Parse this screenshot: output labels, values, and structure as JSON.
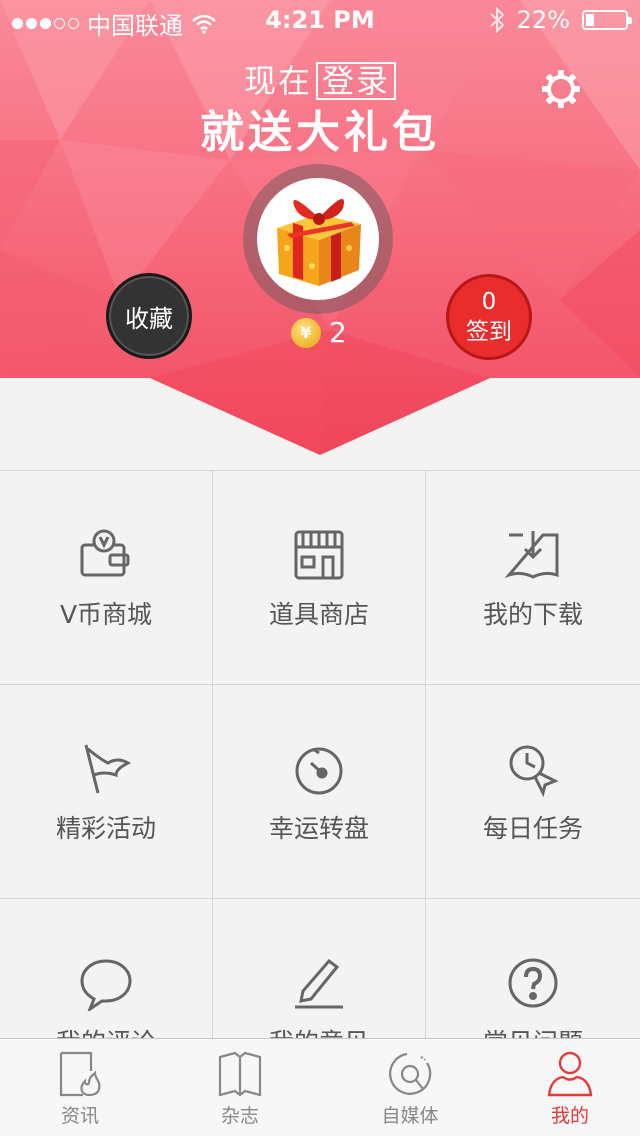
{
  "status_bar": {
    "carrier": "中国联通",
    "time": "4:21 PM",
    "battery_text": "22%",
    "battery_level": 0.22
  },
  "header": {
    "promo_prefix": "现在",
    "login_label": "登录",
    "promo_main": "就送大礼包",
    "coin_count": "2",
    "favorites_label": "收藏",
    "signin_count": "0",
    "signin_label": "签到",
    "colors": {
      "gradient_top": "#f9788a",
      "gradient_bottom": "#f3475d"
    }
  },
  "grid": {
    "items": [
      {
        "label": "V币商城",
        "icon": "wallet-v-icon"
      },
      {
        "label": "道具商店",
        "icon": "shop-icon"
      },
      {
        "label": "我的下载",
        "icon": "book-download-icon"
      },
      {
        "label": "精彩活动",
        "icon": "flag-icon"
      },
      {
        "label": "幸运转盘",
        "icon": "wheel-icon"
      },
      {
        "label": "每日任务",
        "icon": "clock-badge-icon"
      },
      {
        "label": "我的评论",
        "icon": "comment-icon"
      },
      {
        "label": "我的意见",
        "icon": "pen-icon"
      },
      {
        "label": "常见问题",
        "icon": "question-icon"
      }
    ]
  },
  "tabbar": {
    "tabs": [
      {
        "label": "资讯",
        "icon": "news-flame-icon"
      },
      {
        "label": "杂志",
        "icon": "magazine-icon"
      },
      {
        "label": "自媒体",
        "icon": "media-disc-icon"
      },
      {
        "label": "我的",
        "icon": "person-icon"
      }
    ],
    "active_index": 3,
    "active_color": "#e23a3a"
  }
}
